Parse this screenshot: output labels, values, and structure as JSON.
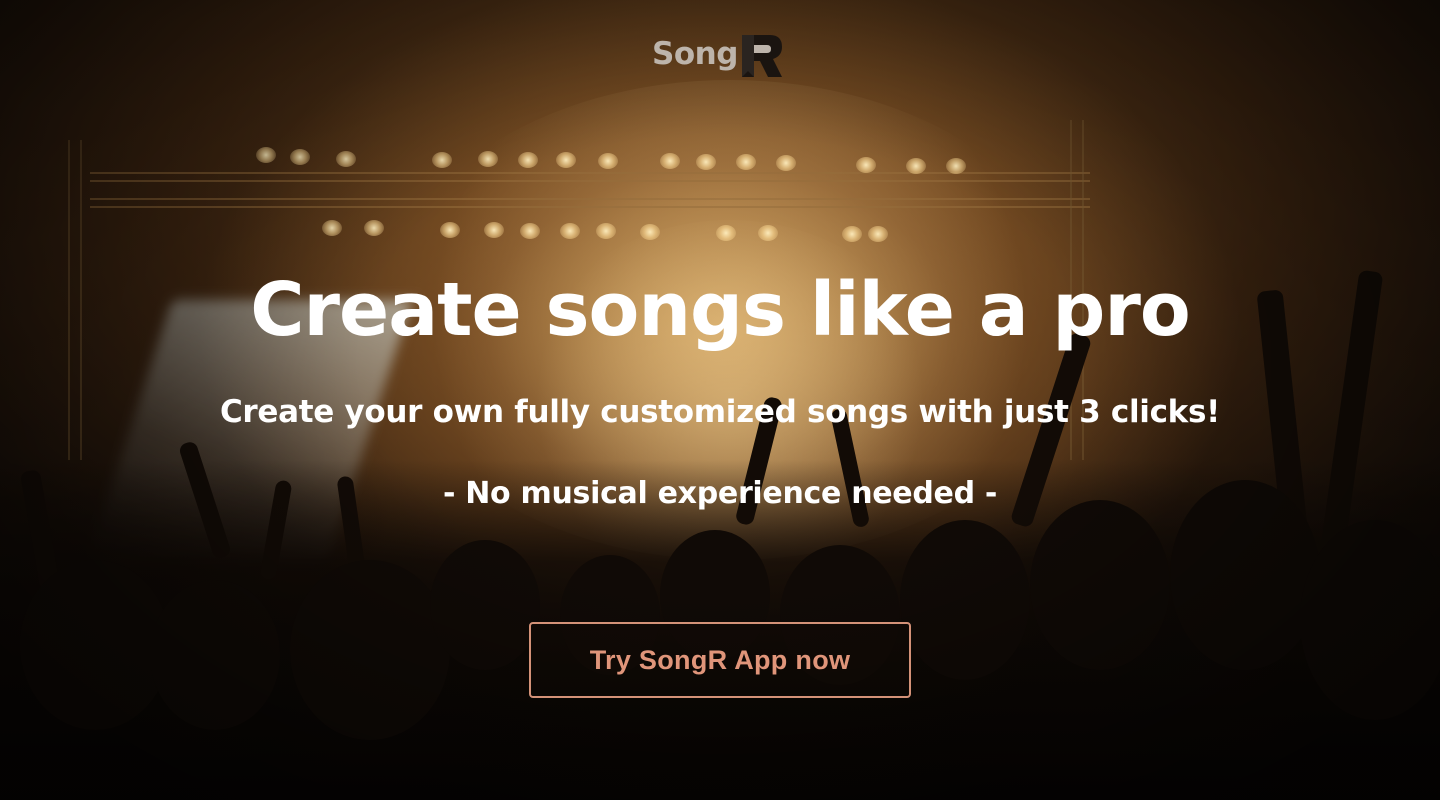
{
  "logo": {
    "text": "Song",
    "mark_letter": "R"
  },
  "hero": {
    "title": "Create songs like a pro",
    "subtitle": "Create your own fully customized songs with just 3 clicks!",
    "note": "- No musical experience needed -"
  },
  "cta": {
    "label": "Try SongR App now"
  },
  "colors": {
    "text": "#ffffff",
    "cta_accent": "#e0957a",
    "cta_border": "#d49278",
    "logo": "#bdb4ab"
  }
}
